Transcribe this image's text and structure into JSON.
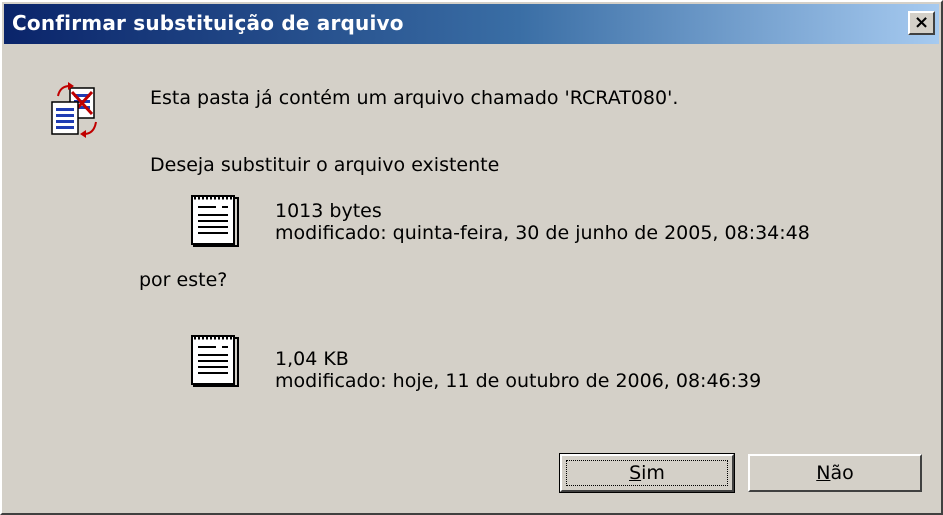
{
  "window": {
    "title": "Confirmar substituição de arquivo",
    "close_glyph": "×"
  },
  "message": {
    "line1": "Esta pasta já contém um arquivo chamado 'RCRAT080'.",
    "line2": "Deseja substituir o arquivo existente",
    "by_this": "por este?"
  },
  "existing_file": {
    "size": "1013 bytes",
    "modified": "modificado: quinta-feira, 30 de junho de 2005, 08:34:48",
    "icon": "document-icon"
  },
  "new_file": {
    "size": "1,04 KB",
    "modified": "modificado: hoje, 11 de outubro de 2006, 08:46:39",
    "icon": "document-icon"
  },
  "dialog_icon": "replace-file-icon",
  "buttons": {
    "yes_first": "S",
    "yes_rest": "im",
    "no_first": "N",
    "no_rest": "ão"
  },
  "colors": {
    "title_start": "#0a246a",
    "title_end": "#a6caf0",
    "face": "#d4d0c8"
  }
}
